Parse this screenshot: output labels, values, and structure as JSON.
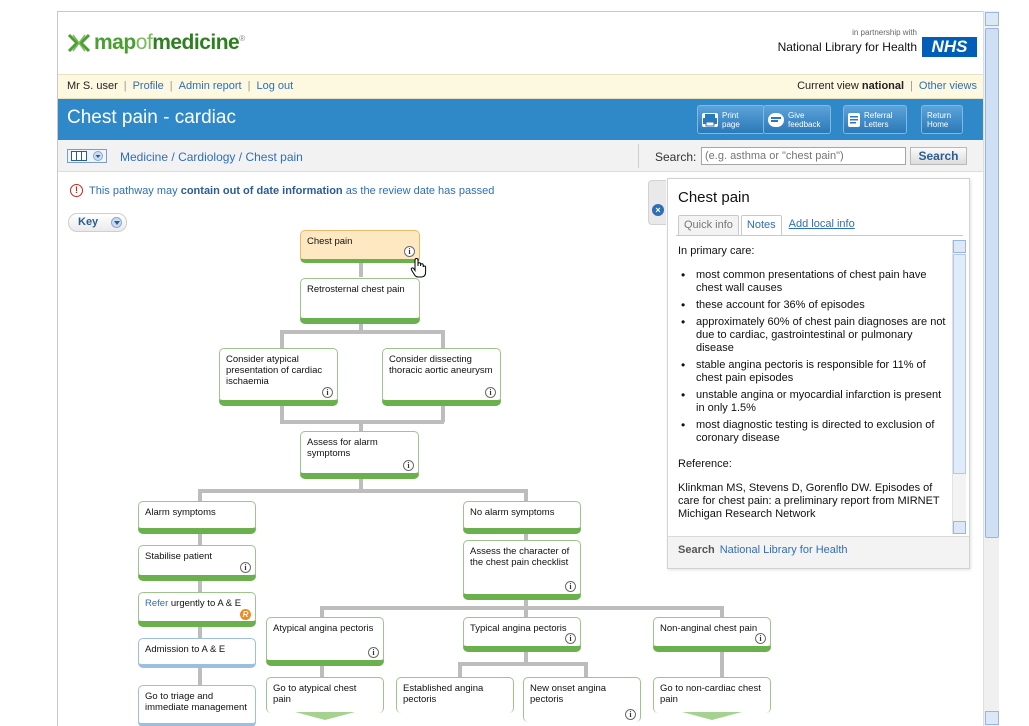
{
  "header": {
    "logo_word_map": "map",
    "logo_word_of": "of",
    "logo_word_medicine": "medicine",
    "logo_reg": "®",
    "partnership_small": "in partnership with",
    "partner_name": "National Library for Health",
    "nhs_logo": "NHS"
  },
  "userbar": {
    "user": "Mr S. user",
    "profile": "Profile",
    "admin_report": "Admin report",
    "logout": "Log out",
    "current_view_prefix": "Current view",
    "current_view_value": "national",
    "other_views": "Other views"
  },
  "titlebar": {
    "title": "Chest pain - cardiac",
    "buttons": [
      {
        "l1": "Print",
        "l2": "page"
      },
      {
        "l1": "Give",
        "l2": "feedback"
      },
      {
        "l1": "Referral",
        "l2": "Letters"
      },
      {
        "l1": "Return",
        "l2": "Home"
      }
    ]
  },
  "breadcrumb": {
    "part1": "Medicine",
    "part2": "Cardiology",
    "part3": "Chest pain",
    "sep": "/"
  },
  "search": {
    "label": "Search:",
    "placeholder": "(e.g. asthma or \"chest pain\")",
    "button": "Search"
  },
  "warning": {
    "prefix": "This pathway may",
    "bold": "contain out of date information",
    "suffix": "as the review date has passed"
  },
  "key_label": "Key",
  "nodes": {
    "chest_pain": "Chest pain",
    "retrosternal": "Retrosternal chest pain",
    "atypical_ischaemia": "Consider atypical presentation of cardiac ischaemia",
    "dissecting": "Consider dissecting thoracic aortic aneurysm",
    "assess_alarm": "Assess for alarm symptoms",
    "alarm": "Alarm symptoms",
    "no_alarm": "No alarm symptoms",
    "stabilise": "Stabilise patient",
    "assess_character": "Assess the character of the chest pain checklist",
    "refer_link": "Refer",
    "refer_rest": "urgently to A & E",
    "admission": "Admission to A & E",
    "triage": "Go to triage and immediate management",
    "atypical_angina": "Atypical angina pectoris",
    "typical_angina": "Typical angina pectoris",
    "nonanginal": "Non-anginal chest pain",
    "goto_atypical": "Go to atypical chest pain",
    "established": "Established angina pectoris",
    "new_onset": "New onset angina pectoris",
    "goto_noncardiac": "Go to non-cardiac chest pain"
  },
  "panel": {
    "title": "Chest pain",
    "tabs": [
      "Quick info",
      "Notes",
      "Add local info"
    ],
    "intro": "In primary care:",
    "bullets": [
      "most common presentations of chest pain have chest wall causes",
      "these account for 36% of episodes",
      "approximately 60% of chest pain diagnoses are not due to cardiac, gastrointestinal or pulmonary disease",
      "stable angina pectoris is responsible for 11% of chest pain episodes",
      "unstable angina or myocardial infarction is present in only 1.5%",
      "most diagnostic testing is directed to exclusion of coronary disease"
    ],
    "reference_label": "Reference:",
    "reference_text": "Klinkman MS, Stevens D, Gorenflo DW. Episodes of care for chest pain: a preliminary report from MIRNET Michigan Research Network",
    "footer_label": "Search",
    "footer_link": "National Library for Health"
  },
  "colors": {
    "brand_green": "#4a9e32",
    "title_blue": "#2f88c8",
    "link_blue": "#2f6fb5",
    "node_green": "#6ab04c",
    "nhs_blue": "#005eb8"
  }
}
